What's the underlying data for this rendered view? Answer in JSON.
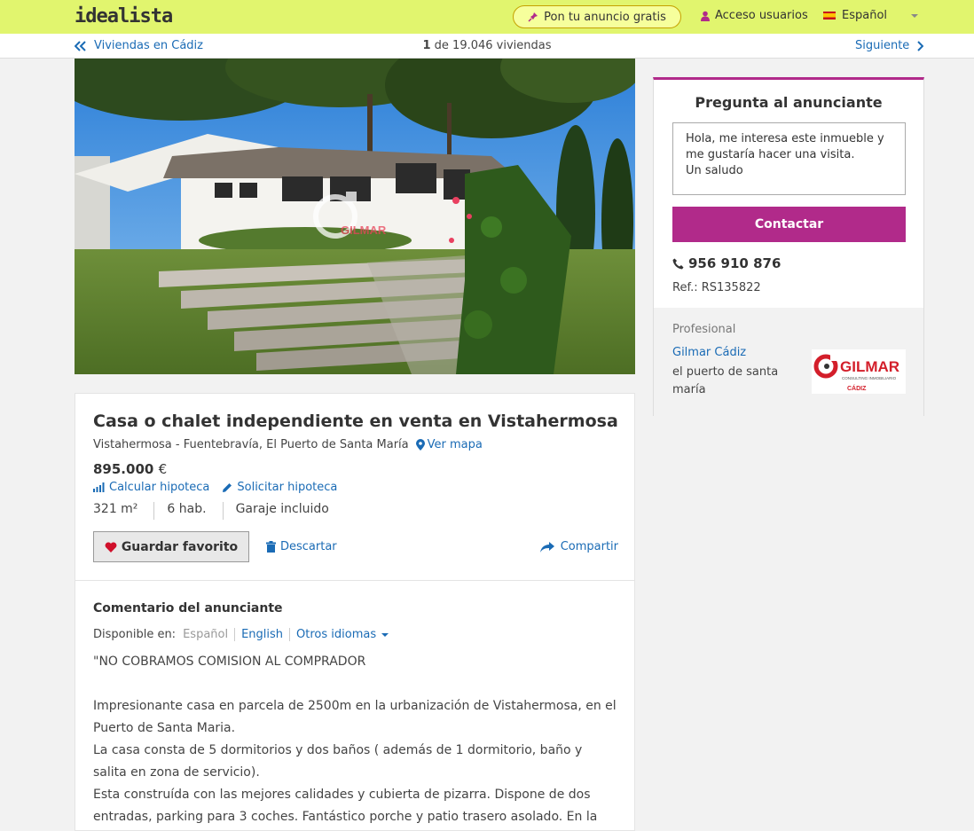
{
  "header": {
    "logo": "idealista",
    "publish_label": "Pon tu anuncio gratis",
    "login_label": "Acceso usuarios",
    "language_label": "Español"
  },
  "nav": {
    "back_label": "Viviendas en Cádiz",
    "count_current": "1",
    "count_rest": "de 19.046 viviendas",
    "next_label": "Siguiente"
  },
  "photo": {
    "watermark": "GILMAR"
  },
  "listing": {
    "title": "Casa o chalet independiente en venta en Vistahermosa",
    "location": "Vistahermosa - Fuentebravía, El Puerto de Santa María",
    "map_link": "Ver mapa",
    "price_amount": "895.000",
    "price_currency": "€",
    "calc_mortgage": "Calcular hipoteca",
    "request_mortgage": "Solicitar hipoteca",
    "features": [
      "321 m²",
      "6 hab.",
      "Garaje incluido"
    ],
    "favorite_label": "Guardar favorito",
    "discard_label": "Descartar",
    "share_label": "Compartir"
  },
  "comment": {
    "title": "Comentario del anunciante",
    "available_label": "Disponible en:",
    "languages": [
      "Español",
      "English",
      "Otros idiomas"
    ],
    "paragraphs": [
      "\"NO COBRAMOS COMISION AL COMPRADOR",
      "",
      "Impresionante casa en parcela de 2500m en la urbanización de Vistahermosa, en el Puerto de Santa Maria.",
      "La casa consta de 5 dormitorios y dos baños ( además de 1 dormitorio, baño y salita en zona de servicio).",
      "Esta construída con las mejores calidades y cubierta de pizarra. Dispone de dos entradas, parking para 3 coches. Fantástico porche y patio trasero asolado. En la planta"
    ]
  },
  "contact": {
    "title": "Pregunta al anunciante",
    "message": "Hola, me interesa este inmueble y\nme gustaría hacer una visita.\nUn saludo",
    "button_label": "Contactar",
    "phone": "956 910 876",
    "ref": "Ref.: RS135822",
    "pro_label": "Profesional",
    "agency_name": "Gilmar Cádiz",
    "agency_location": "el puerto de santa maría",
    "logo_text": "GILMAR",
    "logo_sub": "CONSULTING INMOBILIARIO",
    "logo_city": "CÁDIZ"
  },
  "colors": {
    "header_bg": "#e1f56e",
    "accent": "#b12a8a",
    "link": "#1a6bb5"
  }
}
